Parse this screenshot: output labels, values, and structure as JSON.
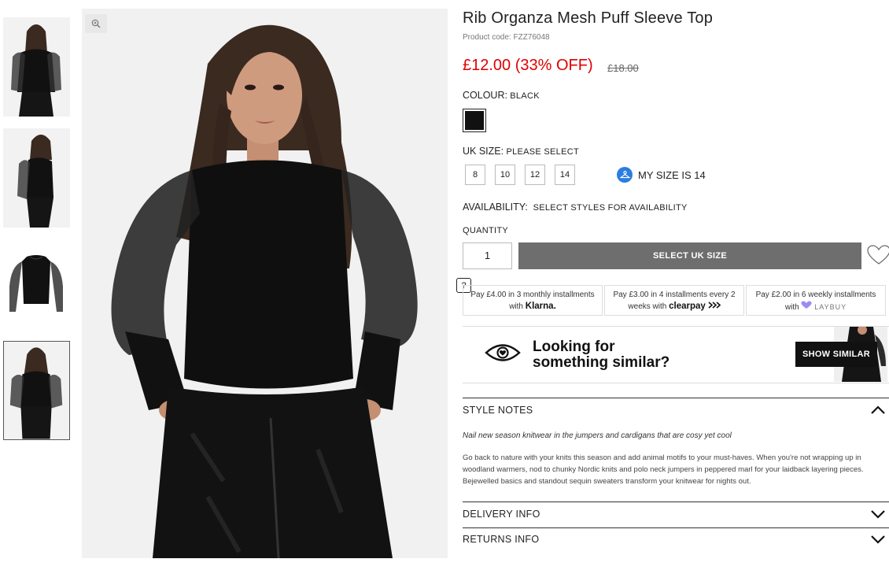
{
  "product": {
    "title": "Rib Organza Mesh Puff Sleeve Top",
    "code": "Product code: FZZ76048",
    "price": "£12.00 (33% OFF)",
    "old_price": "£18.00"
  },
  "colour": {
    "label": "COLOUR:",
    "value": "BLACK",
    "swatch_color": "#111111"
  },
  "size": {
    "label": "UK SIZE:",
    "value": "PLEASE SELECT",
    "options": [
      "8",
      "10",
      "12",
      "14"
    ],
    "my_size": "MY SIZE IS 14"
  },
  "availability": {
    "label": "AVAILABILITY:",
    "value": "SELECT STYLES FOR AVAILABILITY"
  },
  "quantity": {
    "label": "QUANTITY",
    "value": "1"
  },
  "add_button": "SELECT UK SIZE",
  "help_label": "?",
  "payments": {
    "klarna_text": "Pay £4.00 in 3 monthly installments with",
    "klarna_brand": "Klarna.",
    "clearpay_text": "Pay £3.00 in 4 installments every 2 weeks with",
    "clearpay_brand": "clearpay",
    "laybuy_text": "Pay £2.00 in 6 weekly installments with",
    "laybuy_brand": "LAYBUY"
  },
  "similar": {
    "line1": "Looking for",
    "line2": "something similar?",
    "button": "SHOW SIMILAR"
  },
  "style_notes": {
    "title": "STYLE NOTES",
    "tagline": "Nail new season knitwear in the jumpers and cardigans that are cosy yet cool",
    "body": "Go back to nature with your knits this season and add animal motifs to your must-haves. When you're not wrapping up in woodland warmers, nod to chunky Nordic knits and polo neck jumpers in peppered marl for your laidback layering pieces. Bejewelled basics and standout sequin sweaters transform your knitwear for nights out."
  },
  "delivery_title": "DELIVERY INFO",
  "returns_title": "RETURNS INFO",
  "colors": {
    "price_red": "#e00000",
    "button_grey": "#6e6e6e",
    "mysize_blue": "#2b7de0"
  }
}
